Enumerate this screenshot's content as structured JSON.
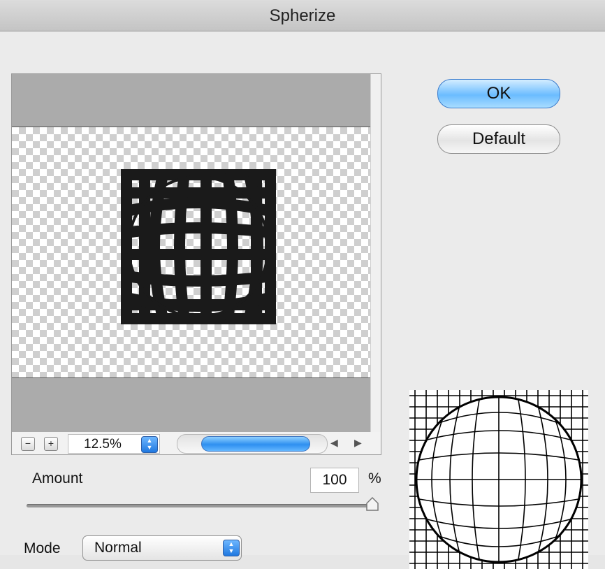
{
  "dialog": {
    "title": "Spherize"
  },
  "buttons": {
    "ok": "OK",
    "default": "Default"
  },
  "zoom": {
    "out_label": "−",
    "in_label": "+",
    "level": "12.5%",
    "up_glyph": "▲",
    "down_glyph": "▼",
    "left_glyph": "◀",
    "right_glyph": "▶"
  },
  "amount": {
    "label": "Amount",
    "value": "100",
    "unit": "%",
    "slider_fraction": 1.0
  },
  "mode": {
    "label": "Mode",
    "selected": "Normal"
  },
  "icons": [
    "zoom-out-icon",
    "zoom-in-icon",
    "stepper-icon",
    "scroll-left-icon",
    "scroll-right-icon",
    "slider-thumb-icon"
  ],
  "colors": {
    "accent": "#2e8ff0",
    "ok_button": "#6bbcff",
    "checker": "#cfcfcf"
  }
}
